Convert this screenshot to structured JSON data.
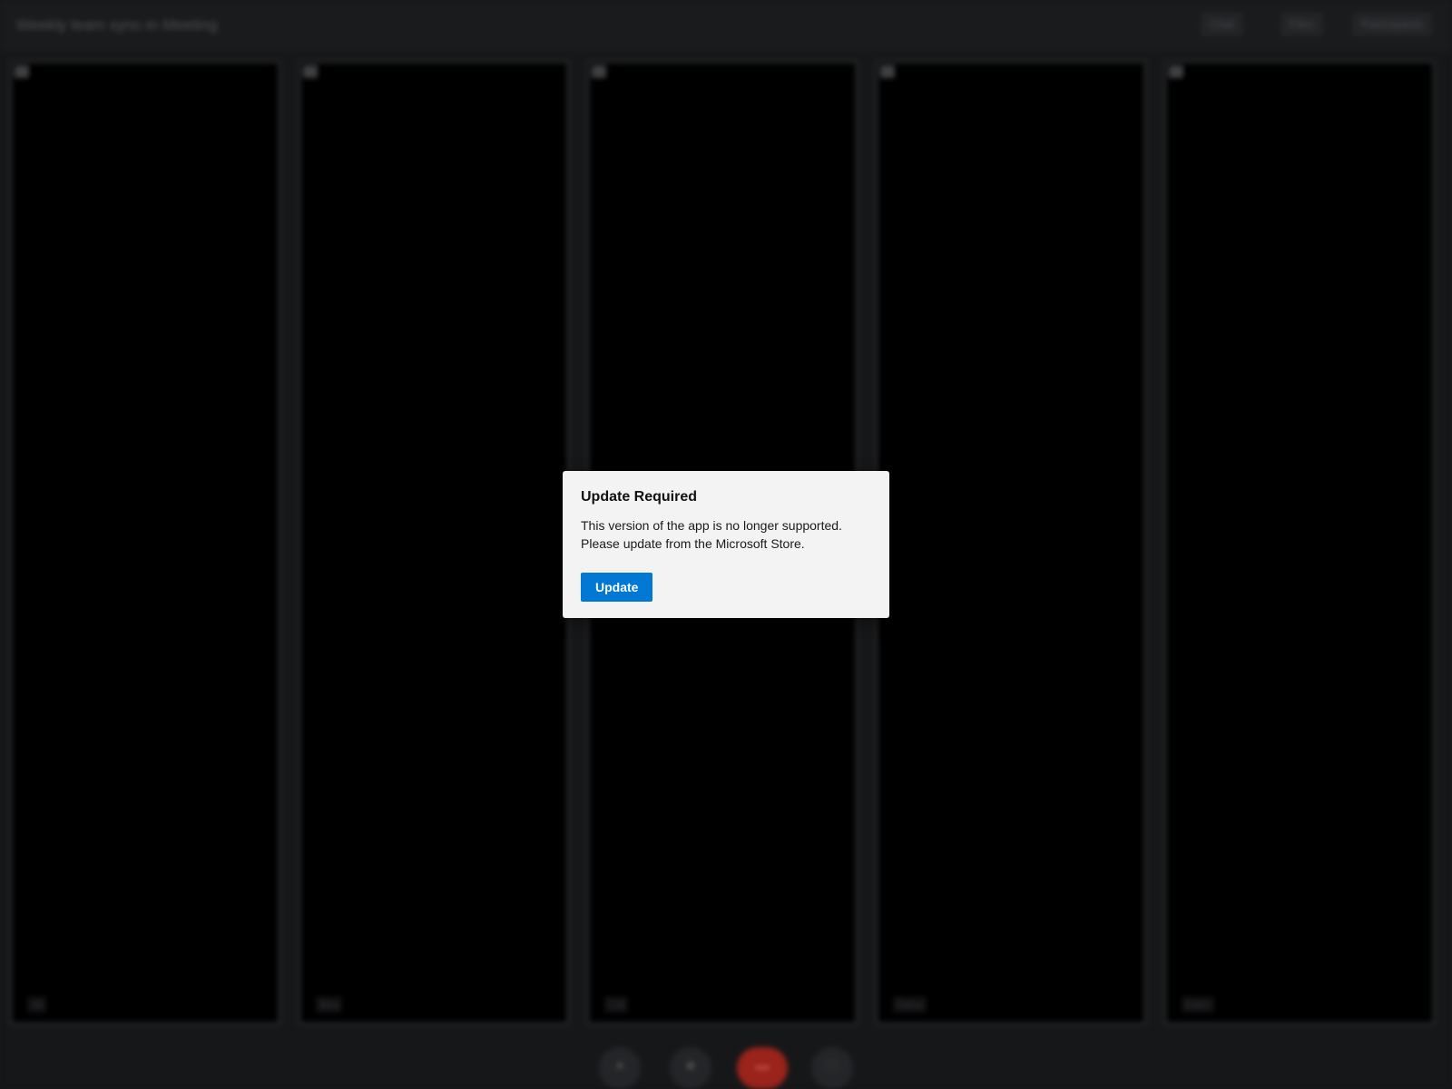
{
  "app": {
    "title": "Weekly team sync-in Meeting",
    "header_buttons": [
      "Chat",
      "Files",
      "Participants"
    ]
  },
  "tiles": [
    {
      "name": "Ali"
    },
    {
      "name": "Bea"
    },
    {
      "name": "Cal"
    },
    {
      "name": "Dana"
    },
    {
      "name": "Eden"
    }
  ],
  "controls": {
    "mic_icon": "microphone-icon",
    "camera_icon": "camera-icon",
    "hangup_icon": "phone-hangup-icon",
    "share_icon": "screen-share-icon"
  },
  "dialog": {
    "title": "Update Required",
    "message_line1": "This version of the app is no longer supported.",
    "message_line2": "Please update from the Microsoft Store.",
    "button_label": "Update",
    "accent_color": "#0078d4"
  }
}
